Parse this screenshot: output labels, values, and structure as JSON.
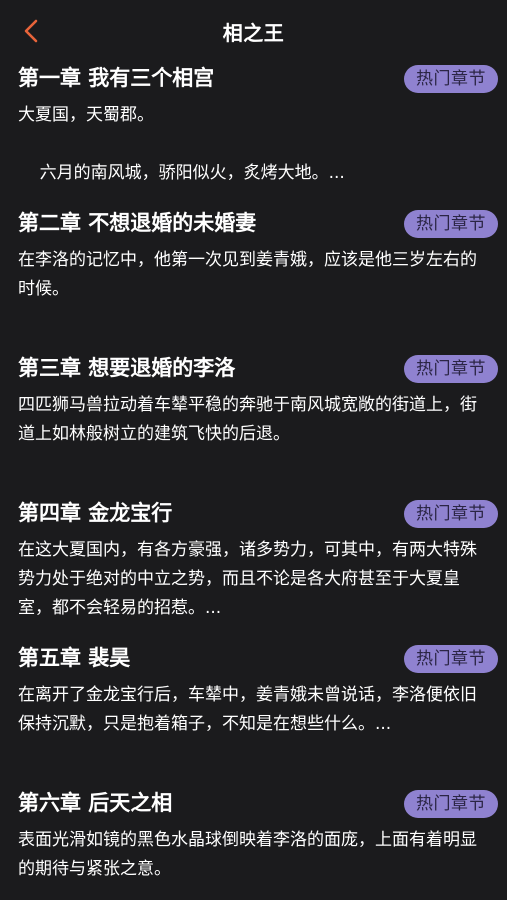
{
  "header": {
    "back_icon": "chevron-left-icon",
    "title": "相之王",
    "accent_color": "#e8643a"
  },
  "badge_color": "#8f82d0",
  "chapters": [
    {
      "title": "第一章 我有三个相宫",
      "badge": "热门章节",
      "excerpt": "大夏国，天蜀郡。\n\n    六月的南风城，骄阳似火，炙烤大地。..."
    },
    {
      "title": "第二章 不想退婚的未婚妻",
      "badge": "热门章节",
      "excerpt": "在李洛的记忆中，他第一次见到姜青娥，应该是他三岁左右的时候。"
    },
    {
      "title": "第三章 想要退婚的李洛",
      "badge": "热门章节",
      "excerpt": "四匹狮马兽拉动着车辇平稳的奔驰于南风城宽敞的街道上，街道上如林般树立的建筑飞快的后退。"
    },
    {
      "title": "第四章 金龙宝行",
      "badge": "热门章节",
      "excerpt": "在这大夏国内，有各方豪强，诸多势力，可其中，有两大特殊势力处于绝对的中立之势，而且不论是各大府甚至于大夏皇室，都不会轻易的招惹。..."
    },
    {
      "title": "第五章 裴昊",
      "badge": "热门章节",
      "excerpt": "在离开了金龙宝行后，车辇中，姜青娥未曾说话，李洛便依旧保持沉默，只是抱着箱子，不知是在想些什么。..."
    },
    {
      "title": "第六章 后天之相",
      "badge": "热门章节",
      "excerpt": "表面光滑如镜的黑色水晶球倒映着李洛的面庞，上面有着明显的期待与紧张之意。"
    }
  ]
}
